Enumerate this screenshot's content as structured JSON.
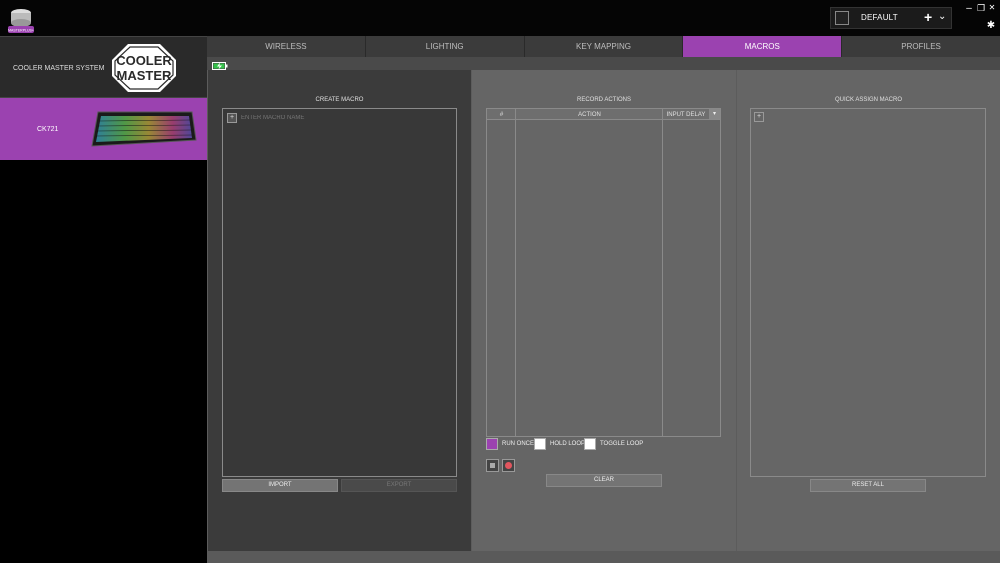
{
  "app": {
    "logo_text": "MASTERPLUS+",
    "profile_name": "DEFAULT",
    "profile_add_symbol": "+",
    "profile_dropdown_symbol": "⌄",
    "minimize_symbol": "–",
    "restore_symbol": "❐",
    "close_symbol": "✕",
    "settings_symbol": "✱"
  },
  "sidebar": {
    "system_label": "COOLER MASTER SYSTEM",
    "brand_line1": "COOLER",
    "brand_line2": "MASTER",
    "device_label": "CK721"
  },
  "tabs": [
    {
      "label": "WIRELESS",
      "active": false
    },
    {
      "label": "LIGHTING",
      "active": false
    },
    {
      "label": "KEY MAPPING",
      "active": false
    },
    {
      "label": "MACROS",
      "active": true
    },
    {
      "label": "PROFILES",
      "active": false
    }
  ],
  "create_macro": {
    "title": "CREATE MACRO",
    "add_symbol": "+",
    "name_placeholder": "ENTER MACRO NAME",
    "import_label": "IMPORT",
    "export_label": "EXPORT"
  },
  "record_actions": {
    "title": "RECORD ACTIONS",
    "col_num": "#",
    "col_action": "ACTION",
    "col_delay": "INPUT DELAY",
    "run_once": "RUN ONCE",
    "hold_loop": "HOLD LOOP",
    "toggle_loop": "TOGGLE LOOP",
    "selected_mode": "RUN ONCE",
    "clear_label": "CLEAR"
  },
  "quick_assign": {
    "title": "QUICK ASSIGN MACRO",
    "add_symbol": "+",
    "reset_label": "RESET ALL"
  },
  "colors": {
    "accent": "#9b42b0",
    "panel_dark": "#3b3b3b",
    "panel_mid": "#656565"
  }
}
